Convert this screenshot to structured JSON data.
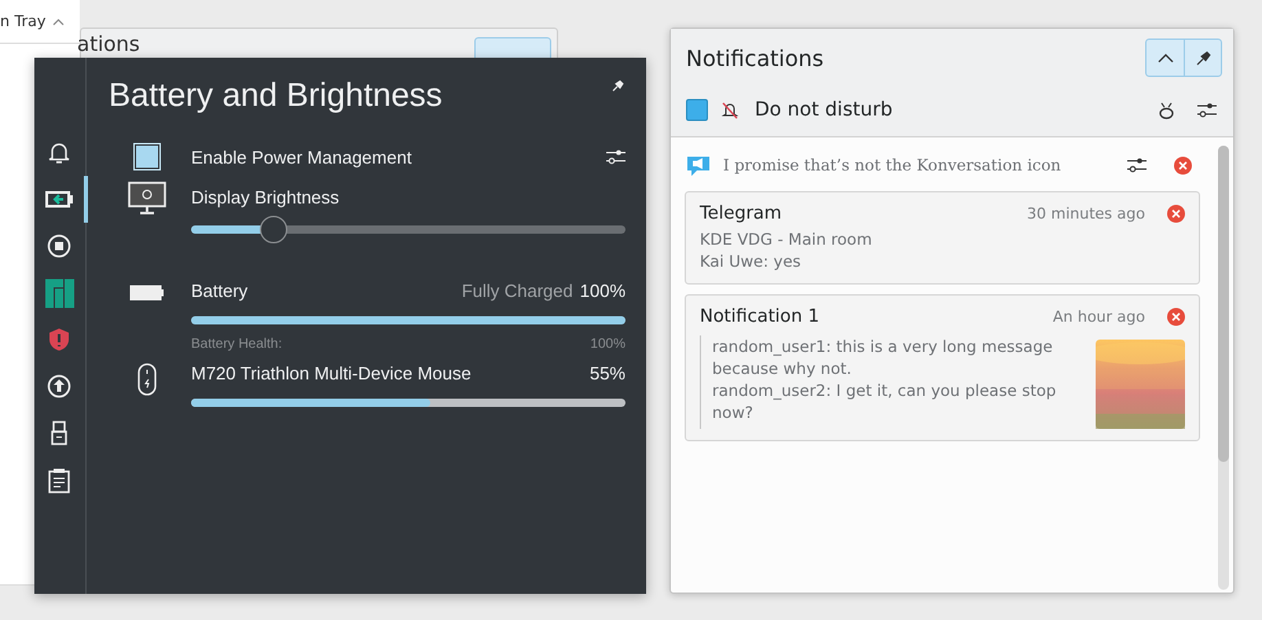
{
  "background_window": {
    "title": "n Tray"
  },
  "background_popup": {
    "title": "ations"
  },
  "battery_popup": {
    "title": "Battery and Brightness",
    "sidebar": [
      {
        "kind": "bell",
        "selected": false
      },
      {
        "kind": "battery",
        "selected": true
      },
      {
        "kind": "stop",
        "selected": false
      },
      {
        "kind": "logo",
        "selected": false
      },
      {
        "kind": "shield",
        "selected": false
      },
      {
        "kind": "upload",
        "selected": false
      },
      {
        "kind": "usb",
        "selected": false
      },
      {
        "kind": "clipboard",
        "selected": false
      }
    ],
    "power_management": {
      "label": "Enable Power Management",
      "checked": true
    },
    "brightness": {
      "label": "Display Brightness",
      "level": 0.19
    },
    "battery": {
      "label": "Battery",
      "status": "Fully Charged",
      "percent": "100%",
      "level": 1,
      "health_label": "Battery Health:",
      "health_value": "100%"
    },
    "mouse": {
      "label": "M720 Triathlon Multi-Device Mouse",
      "percent": "55%",
      "level": 0.55
    }
  },
  "notifications": {
    "title": "Notifications",
    "dnd": {
      "label": "Do not disturb",
      "checked": true
    },
    "group": {
      "title": "I promise that’s not the Konversation icon"
    },
    "items": [
      {
        "title": "Telegram",
        "time": "30 minutes ago",
        "lines": [
          "KDE VDG - Main room",
          "Kai Uwe: yes"
        ]
      },
      {
        "title": "Notification 1",
        "time": "An hour ago",
        "lines": [
          "random_user1: this is a very long message because why not.",
          "random_user2: I get it, can you please stop now?"
        ]
      }
    ]
  }
}
